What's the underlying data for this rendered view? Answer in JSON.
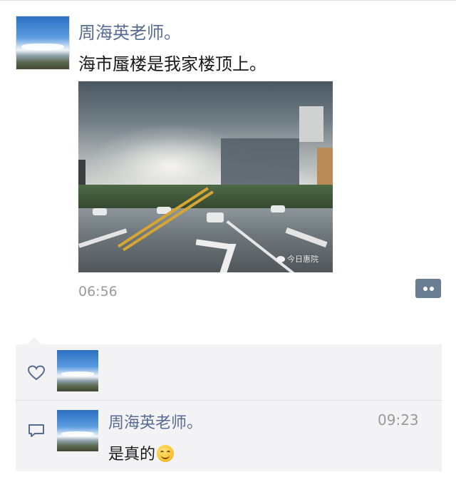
{
  "post": {
    "author": "周海英老师。",
    "text": "海市蜃楼是我家楼顶上。",
    "time": "06:56",
    "image_watermark": "今日惠院"
  },
  "interactions": {
    "like_icon": "heart-icon",
    "comment_icon": "comment-icon",
    "comments": [
      {
        "author": "周海英老师。",
        "time": "09:23",
        "text": "是真的"
      }
    ]
  },
  "colors": {
    "name_link": "#566b94",
    "timestamp": "#9a9a9a",
    "panel_bg": "#f3f3f5",
    "comment_button": "#6a7e93"
  }
}
